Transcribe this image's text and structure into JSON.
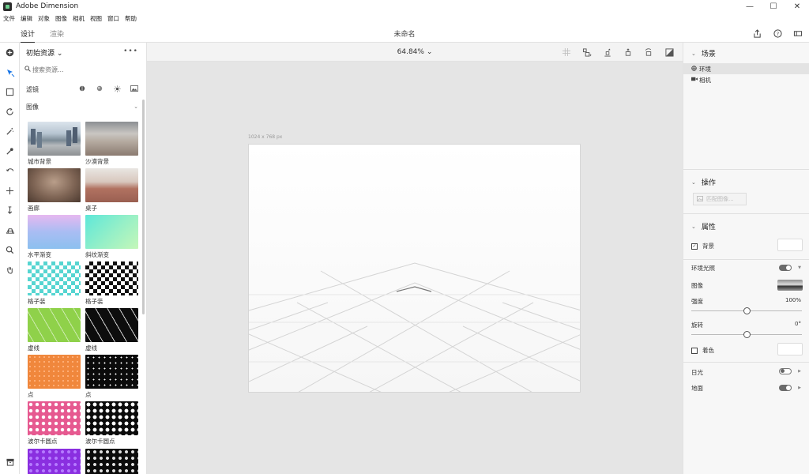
{
  "window": {
    "title": "Adobe Dimension",
    "controls": {
      "minimize": "—",
      "maximize": "☐",
      "close": "✕"
    }
  },
  "menu": [
    "文件",
    "编辑",
    "对象",
    "图像",
    "相机",
    "视图",
    "窗口",
    "帮助"
  ],
  "top": {
    "tabs": [
      {
        "label": "设计",
        "active": true
      },
      {
        "label": "渲染",
        "active": false
      }
    ],
    "doc_title": "未命名",
    "icons": [
      "share-icon",
      "help-icon",
      "learn-icon"
    ]
  },
  "toolbar": {
    "tools": [
      "add-icon",
      "select-icon",
      "rect-select-icon",
      "orbit-icon",
      "magic-wand-icon",
      "sampler-icon",
      "pan-orbit-icon",
      "move-icon",
      "dolly-icon",
      "horizon-icon",
      "zoom-icon",
      "hand-icon"
    ],
    "bottom": "assets-icon"
  },
  "assets": {
    "header": "初始资源",
    "header_chev": "⌄",
    "more": "•••",
    "search_placeholder": "搜索资源...",
    "filter_label": "滤镜",
    "section": "图像",
    "section_chev": "⌄",
    "items": [
      {
        "label": "城市背景",
        "style": "t-city"
      },
      {
        "label": "沙漠背景",
        "style": "t-desert"
      },
      {
        "label": "画廊",
        "style": "t-gallery"
      },
      {
        "label": "桌子",
        "style": "t-room"
      },
      {
        "label": "水平渐变",
        "style": "t-grad1"
      },
      {
        "label": "斜纹渐变",
        "style": "t-grad2"
      },
      {
        "label": "格子装",
        "style": "t-check1"
      },
      {
        "label": "格子装",
        "style": "t-check2"
      },
      {
        "label": "虚线",
        "style": "t-dash1"
      },
      {
        "label": "虚线",
        "style": "t-dash2"
      },
      {
        "label": "点",
        "style": "t-dot1"
      },
      {
        "label": "点",
        "style": "t-dot2"
      },
      {
        "label": "波尔卡圆点",
        "style": "t-polka1"
      },
      {
        "label": "波尔卡圆点",
        "style": "t-polka2"
      },
      {
        "label": "",
        "style": "t-purple"
      },
      {
        "label": "",
        "style": "t-black3"
      }
    ]
  },
  "canvas": {
    "zoom": "64.84%",
    "zoom_chev": "⌄",
    "size_label": "1024 x 768 px"
  },
  "right_panel": {
    "scene": {
      "title": "场景",
      "items": [
        {
          "label": "环境",
          "selected": true
        },
        {
          "label": "相机",
          "selected": false
        }
      ]
    },
    "actions": {
      "title": "操作",
      "button": "匹配图像..."
    },
    "properties": {
      "title": "属性",
      "background_label": "背景",
      "env_light_label": "环境光照",
      "image_label": "图像",
      "intensity_label": "强度",
      "intensity_value": "100%",
      "intensity_level": 0.5,
      "rotation_label": "旋转",
      "rotation_value": "0°",
      "rotation_level": 0.5,
      "tint_label": "着色",
      "sunlight_label": "日光",
      "ground_label": "地面"
    }
  }
}
